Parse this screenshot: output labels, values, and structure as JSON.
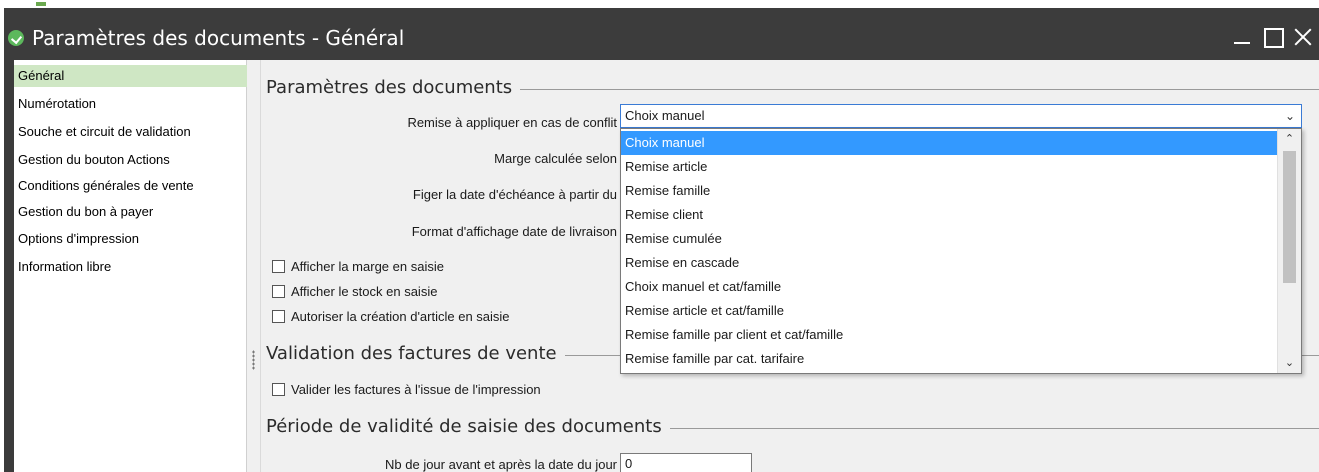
{
  "window": {
    "title": "Paramètres des documents -  Général"
  },
  "sidebar": {
    "items": [
      {
        "label": "Général"
      },
      {
        "label": "Numérotation"
      },
      {
        "label": "Souche et circuit de validation"
      },
      {
        "label": "Gestion du bouton Actions"
      },
      {
        "label": "Conditions générales de vente"
      },
      {
        "label": "Gestion du bon à payer"
      },
      {
        "label": "Options d'impression"
      },
      {
        "label": "Information libre"
      }
    ]
  },
  "sections": {
    "params_title": "Paramètres des documents",
    "validation_title": "Validation des factures de vente",
    "periode_title": "Période de validité de saisie des documents"
  },
  "fields": {
    "remise_label": "Remise à appliquer en cas de conflit",
    "marge_label": "Marge calculée selon",
    "echeance_label": "Figer la date d'échéance à partir du",
    "format_label": "Format d'affichage date de livraison",
    "nb_jour_label": "Nb de jour avant et après la date du jour",
    "nb_jour_value": "0"
  },
  "combo": {
    "selected": "Choix manuel",
    "options": [
      "Choix manuel",
      "Remise article",
      "Remise famille",
      "Remise client",
      "Remise cumulée",
      "Remise en cascade",
      "Choix manuel et cat/famille",
      "Remise article et cat/famille",
      "Remise famille par client et cat/famille",
      "Remise famille par cat. tarifaire"
    ]
  },
  "checkboxes": {
    "afficher_marge": "Afficher la marge en saisie",
    "afficher_stock": "Afficher le stock en saisie",
    "autoriser_article": "Autoriser la création d'article en saisie",
    "valider_factures": "Valider les factures à l'issue de l'impression"
  },
  "colors": {
    "titlebar": "#3c3c3c",
    "active_item": "#cfe7c4",
    "selection": "#3399ff",
    "focus_border": "#3a7bd5"
  }
}
